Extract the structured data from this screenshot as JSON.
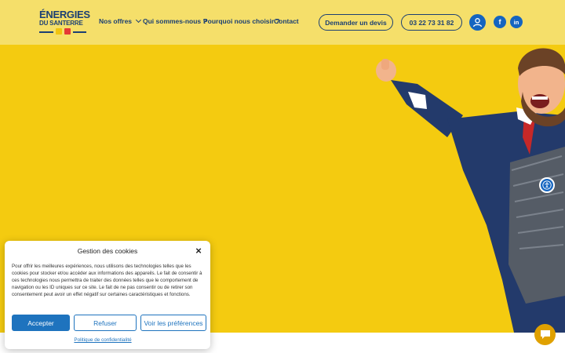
{
  "header": {
    "logo_line1": "ÉNERGIES",
    "logo_line2": "DU SANTERRE",
    "nav": [
      {
        "label": "Nos offres"
      },
      {
        "label": "Qui sommes-nous ?"
      },
      {
        "label": "Pourquoi nous choisir ?"
      },
      {
        "label": "Contact"
      }
    ],
    "quote_button": "Demander un devis",
    "phone_button": "03 22 73 31 82",
    "facebook_glyph": "f",
    "linkedin_glyph": "in"
  },
  "cookie": {
    "title": "Gestion des cookies",
    "text": "Pour offrir les meilleures expériences, nous utilisons des technologies telles que les cookies pour stocker et/ou accéder aux informations des appareils. Le fait de consentir à ces technologies nous permettra de traiter des données telles que le comportement de navigation ou les ID uniques sur ce site. Le fait de ne pas consentir ou de retirer son consentement peut avoir un effet négatif sur certaines caractéristiques et fonctions.",
    "accept": "Accepter",
    "refuse": "Refuser",
    "preferences": "Voir les préférences",
    "privacy_link": "Politique de confidentialité"
  },
  "colors": {
    "header_bg": "#f5df6a",
    "hero_bg": "#f4cb10",
    "brand_blue": "#1b3f73",
    "accent_blue": "#1e73be",
    "chat_orange": "#e0a100"
  },
  "icons": [
    "user-icon",
    "facebook-icon",
    "linkedin-icon",
    "accessibility-icon",
    "close-icon",
    "chat-icon",
    "chevron-down-icon"
  ]
}
